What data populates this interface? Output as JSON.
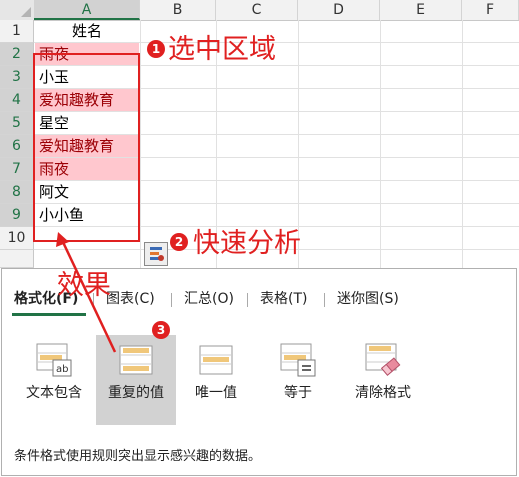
{
  "columns": [
    "A",
    "B",
    "C",
    "D",
    "E",
    "F"
  ],
  "rows": [
    "1",
    "2",
    "3",
    "4",
    "5",
    "6",
    "7",
    "8",
    "9",
    "10"
  ],
  "cells": {
    "header": "姓名",
    "values": [
      "雨夜",
      "小玉",
      "爱知趣教育",
      "星空",
      "爱知趣教育",
      "雨夜",
      "阿文",
      "小小鱼"
    ],
    "duplicate": [
      true,
      false,
      true,
      false,
      true,
      true,
      false,
      false
    ]
  },
  "annotations": {
    "step1_num": "1",
    "step1_text": "选中区域",
    "step2_num": "2",
    "step2_text": "快速分析",
    "step3_num": "3",
    "effect_text": "效果"
  },
  "quick_analysis": {
    "tabs": [
      "格式化(F)",
      "图表(C)",
      "汇总(O)",
      "表格(T)",
      "迷你图(S)"
    ],
    "active_tab": "格式化(F)",
    "tools": [
      {
        "label": "文本包含",
        "icon": "text-contains-icon"
      },
      {
        "label": "重复的值",
        "icon": "duplicate-values-icon"
      },
      {
        "label": "唯一值",
        "icon": "unique-values-icon"
      },
      {
        "label": "等于",
        "icon": "equal-to-icon"
      },
      {
        "label": "清除格式",
        "icon": "clear-format-icon"
      }
    ],
    "highlighted_tool": "重复的值",
    "description": "条件格式使用规则突出显示感兴趣的数据。"
  },
  "colors": {
    "duplicate_fill": "#ffc7ce",
    "duplicate_text": "#9c0006",
    "annotation_red": "#e02020",
    "excel_green": "#217346"
  }
}
